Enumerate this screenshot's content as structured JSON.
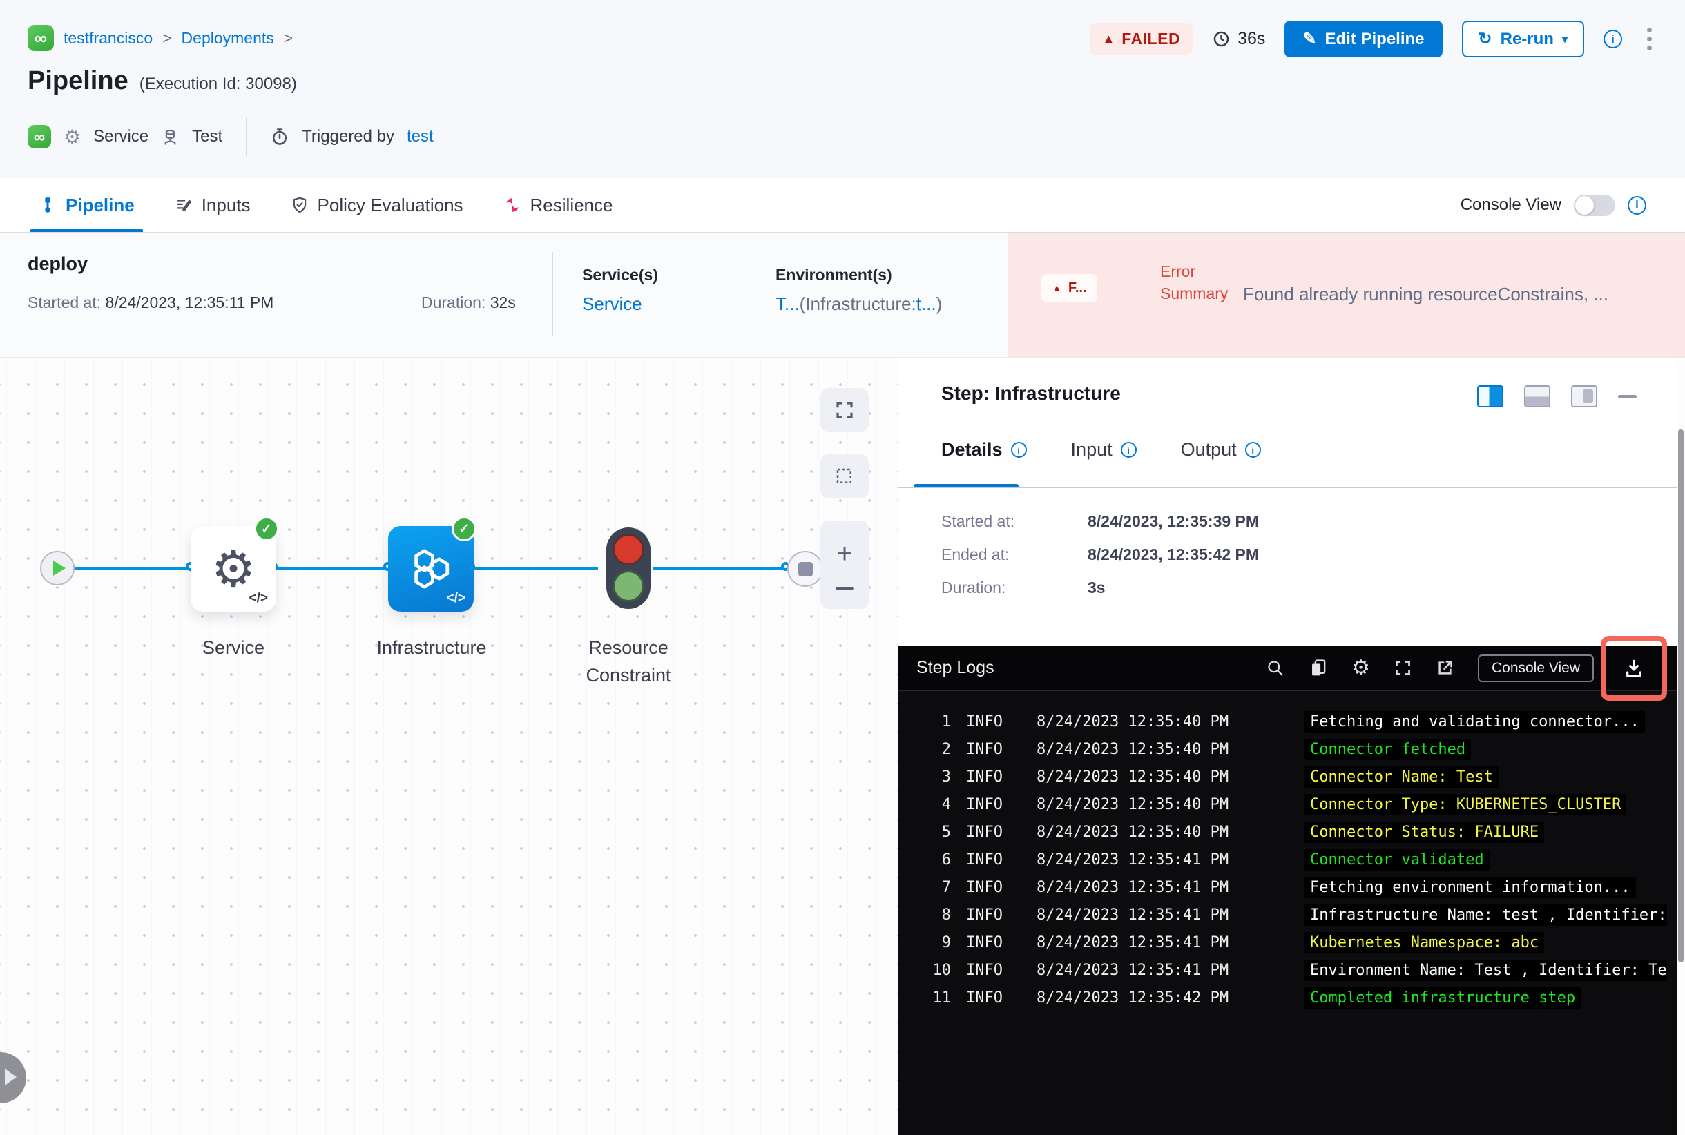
{
  "icons": {
    "logo_glyph": "∞",
    "gear": "⚙",
    "pencil": "✎",
    "rerun": "↻",
    "caret_down": "▾",
    "warning": "▲",
    "check": "✓",
    "code": "</>",
    "plus": "+",
    "info": "i"
  },
  "header": {
    "breadcrumb": {
      "project": "testfrancisco",
      "sep": ">",
      "section": "Deployments"
    },
    "title": "Pipeline",
    "execution_id": "(Execution Id: 30098)",
    "meta": {
      "service_label": "Service",
      "test_label": "Test",
      "triggered_by_label": "Triggered by",
      "triggered_by_value": "test"
    },
    "status_badge": "FAILED",
    "duration": "36s",
    "edit_pipeline_label": "Edit Pipeline",
    "rerun_label": "Re-run"
  },
  "tabs": {
    "items": [
      {
        "label": "Pipeline"
      },
      {
        "label": "Inputs"
      },
      {
        "label": "Policy Evaluations"
      },
      {
        "label": "Resilience"
      }
    ],
    "console_view_label": "Console View"
  },
  "summary": {
    "stage_name": "deploy",
    "started_label": "Started at:",
    "started_value": "8/24/2023, 12:35:11 PM",
    "duration_label": "Duration:",
    "duration_value": "32s",
    "services_label": "Service(s)",
    "services_value": "Service",
    "environments_label": "Environment(s)",
    "env_part1": "T...",
    "env_part2": "(Infrastructure:",
    "env_part3": "t...",
    "env_part4": ")",
    "failed_short": "F...",
    "error_label_line1": "Error",
    "error_label_line2": "Summary",
    "error_text": "Found already running resourceConstrains, ..."
  },
  "canvas": {
    "service_label": "Service",
    "infrastructure_label": "Infrastructure",
    "resource_constraint_line1": "Resource",
    "resource_constraint_line2": "Constraint"
  },
  "panel": {
    "title": "Step: Infrastructure",
    "tabs": [
      "Details",
      "Input",
      "Output"
    ],
    "details": {
      "started_label": "Started at:",
      "started_value": "8/24/2023, 12:35:39 PM",
      "ended_label": "Ended at:",
      "ended_value": "8/24/2023, 12:35:42 PM",
      "duration_label": "Duration:",
      "duration_value": "3s"
    }
  },
  "logs": {
    "title": "Step Logs",
    "console_view_label": "Console View",
    "rows": [
      {
        "n": "1",
        "level": "INFO",
        "time": "8/24/2023 12:35:40 PM",
        "msg": "Fetching and validating connector...",
        "color": "white"
      },
      {
        "n": "2",
        "level": "INFO",
        "time": "8/24/2023 12:35:40 PM",
        "msg": "Connector fetched",
        "color": "green"
      },
      {
        "n": "3",
        "level": "INFO",
        "time": "8/24/2023 12:35:40 PM",
        "msg": "Connector Name: Test",
        "color": "yellow"
      },
      {
        "n": "4",
        "level": "INFO",
        "time": "8/24/2023 12:35:40 PM",
        "msg": "Connector Type: KUBERNETES_CLUSTER",
        "color": "yellow"
      },
      {
        "n": "5",
        "level": "INFO",
        "time": "8/24/2023 12:35:40 PM",
        "msg": "Connector Status: FAILURE",
        "color": "yellow"
      },
      {
        "n": "6",
        "level": "INFO",
        "time": "8/24/2023 12:35:41 PM",
        "msg": "Connector validated",
        "color": "green"
      },
      {
        "n": "7",
        "level": "INFO",
        "time": "8/24/2023 12:35:41 PM",
        "msg": "Fetching environment information...",
        "color": "white"
      },
      {
        "n": "8",
        "level": "INFO",
        "time": "8/24/2023 12:35:41 PM",
        "msg": "Infrastructure Name: test , Identifier:",
        "color": "white"
      },
      {
        "n": "9",
        "level": "INFO",
        "time": "8/24/2023 12:35:41 PM",
        "msg": "Kubernetes Namespace: abc",
        "color": "yellow"
      },
      {
        "n": "10",
        "level": "INFO",
        "time": "8/24/2023 12:35:41 PM",
        "msg": "Environment Name: Test , Identifier: Te",
        "color": "white"
      },
      {
        "n": "11",
        "level": "INFO",
        "time": "8/24/2023 12:35:42 PM",
        "msg": "Completed infrastructure step",
        "color": "green"
      }
    ]
  },
  "colors": {
    "primary_blue": "#0278d5",
    "connector_blue": "#0092e4",
    "failed_red": "#b41710",
    "error_bg": "#fbe7e5",
    "success_green": "#3fae47",
    "highlight_red": "#f4655b",
    "log_green": "#21e421",
    "log_yellow": "#f5f542"
  }
}
